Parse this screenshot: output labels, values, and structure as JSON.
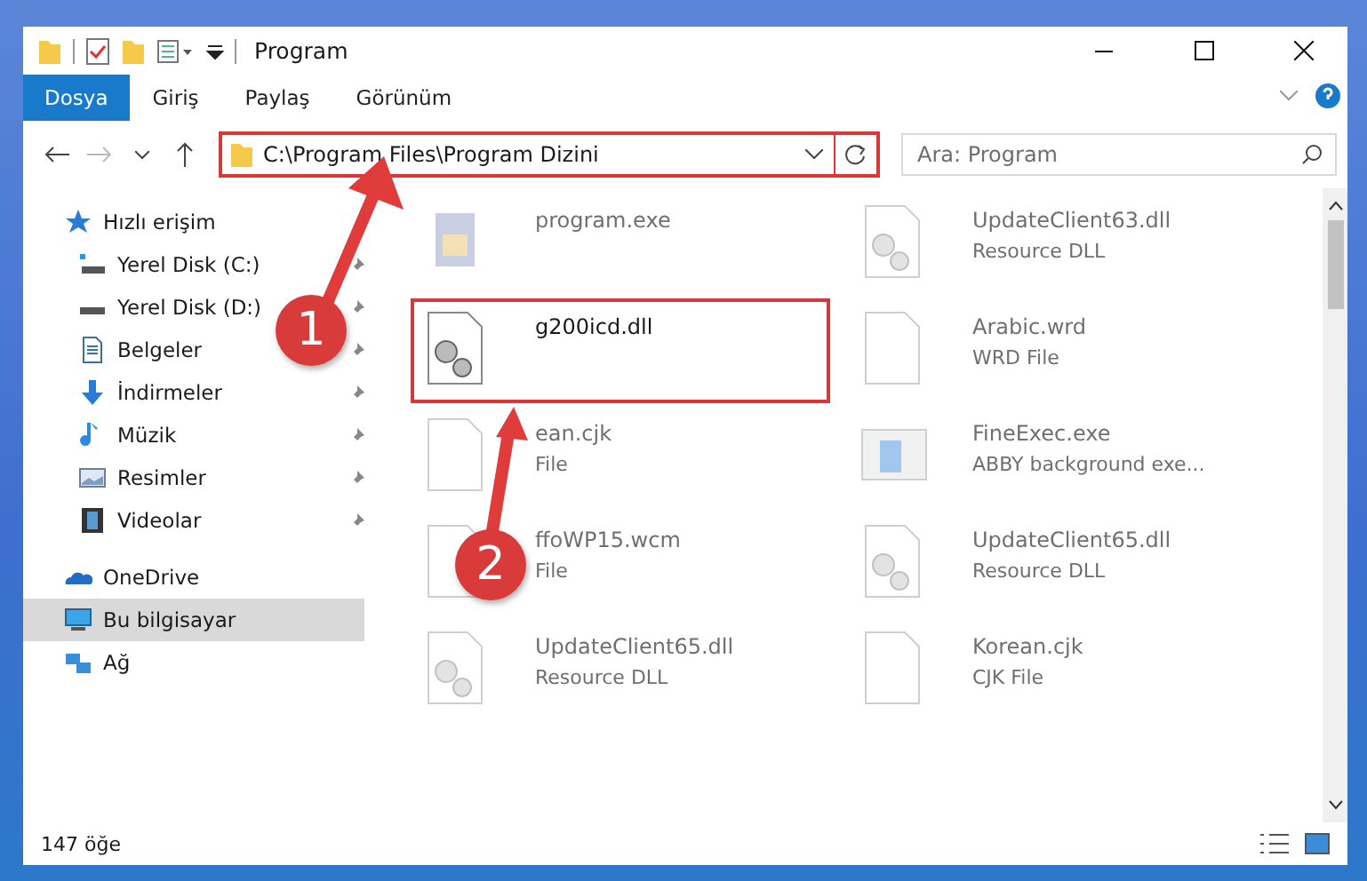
{
  "window": {
    "title": "Program"
  },
  "ribbon_tabs": [
    {
      "label": "Dosya",
      "selected": true
    },
    {
      "label": "Giriş",
      "selected": false
    },
    {
      "label": "Paylaş",
      "selected": false
    },
    {
      "label": "Görünüm",
      "selected": false
    }
  ],
  "address": {
    "path": "C:\\Program Files\\Program Dizini",
    "highlighted": true
  },
  "search": {
    "placeholder": "Ara: Program"
  },
  "sidebar": {
    "items": [
      {
        "label": "Hızlı erişim",
        "kind": "star",
        "selected": false,
        "children": [
          {
            "label": "Yerel Disk (C:)",
            "kind": "drive-c",
            "pinned": true
          },
          {
            "label": "Yerel Disk (D:)",
            "kind": "drive",
            "pinned": true
          },
          {
            "label": "Belgeler",
            "kind": "docs",
            "pinned": true
          },
          {
            "label": "İndirmeler",
            "kind": "download",
            "pinned": true
          },
          {
            "label": "Müzik",
            "kind": "music",
            "pinned": true
          },
          {
            "label": "Resimler",
            "kind": "pictures",
            "pinned": true
          },
          {
            "label": "Videolar",
            "kind": "videos",
            "pinned": true
          }
        ]
      },
      {
        "label": "OneDrive",
        "kind": "cloud",
        "selected": false
      },
      {
        "label": "Bu bilgisayar",
        "kind": "pc",
        "selected": true
      },
      {
        "label": "Ağ",
        "kind": "network",
        "selected": false
      }
    ]
  },
  "files": [
    {
      "name": "program.exe",
      "kind": "exe",
      "faded": true,
      "highlighted": false
    },
    {
      "name": "UpdateClient63.dll",
      "type": "Resource DLL",
      "kind": "dll",
      "faded": true,
      "highlighted": false
    },
    {
      "name": "g200icd.dll",
      "kind": "dll",
      "faded": false,
      "highlighted": true
    },
    {
      "name": "Arabic.wrd",
      "type": "WRD File",
      "kind": "file",
      "faded": true,
      "highlighted": false
    },
    {
      "name": "ean.cjk",
      "type": "File",
      "kind": "file",
      "faded": true,
      "highlighted": false
    },
    {
      "name": "FineExec.exe",
      "type": "ABBY background exe...",
      "kind": "app",
      "faded": true,
      "highlighted": false
    },
    {
      "name": "ffoWP15.wcm",
      "type": "File",
      "kind": "file",
      "faded": true,
      "highlighted": false
    },
    {
      "name": "UpdateClient65.dll",
      "type": "Resource DLL",
      "kind": "dll",
      "faded": true,
      "highlighted": false
    },
    {
      "name": "UpdateClient65.dll",
      "type": "Resource DLL",
      "kind": "dll",
      "faded": true,
      "highlighted": false
    },
    {
      "name": "Korean.cjk",
      "type": "CJK File",
      "kind": "file",
      "faded": true,
      "highlighted": false
    }
  ],
  "status_bar": {
    "count": "147 öğe"
  },
  "callouts": [
    {
      "number": "1"
    },
    {
      "number": "2"
    }
  ]
}
